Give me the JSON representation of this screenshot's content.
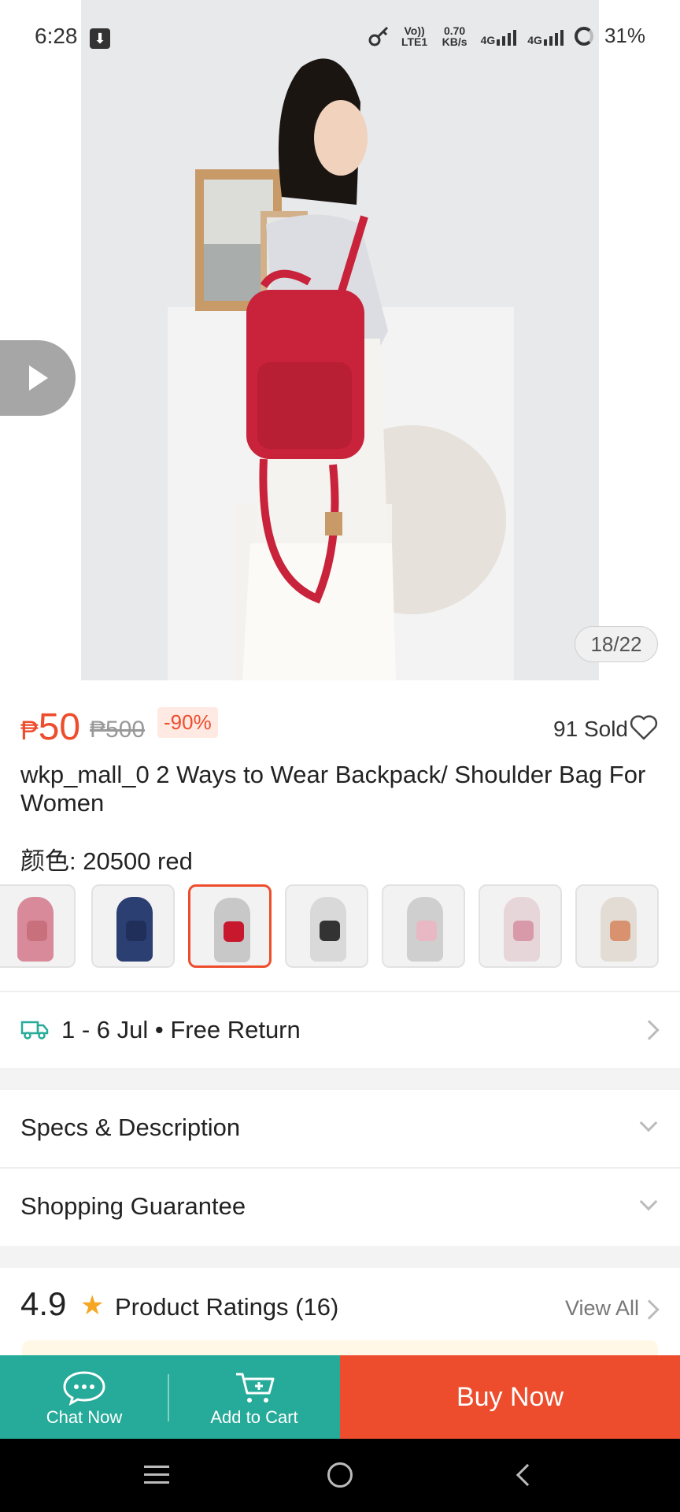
{
  "status_bar": {
    "time": "6:28",
    "net_volte": "Vo)) LTE1",
    "net_speed": "0.70 KB/s",
    "net_4g_1": "4G",
    "net_4g_2": "4G",
    "battery": "31%"
  },
  "gallery": {
    "counter": "18/22",
    "current_index": 18,
    "total": 22
  },
  "product": {
    "price_currency": "₱",
    "price": "50",
    "original_price": "₱500",
    "discount": "-90%",
    "sold": "91 Sold",
    "title": "wkp_mall_0 2 Ways to Wear Backpack/ Shoulder Bag For Women",
    "color_label": "颜色: 20500 red",
    "variants": [
      {
        "color": "#d98a9a",
        "bag": "#c9707d",
        "selected": false
      },
      {
        "color": "#2b3f73",
        "bag": "#1f2f5a",
        "selected": false
      },
      {
        "color": "#c8c8c8",
        "bag": "#c8182e",
        "selected": true
      },
      {
        "color": "#d9d9d9",
        "bag": "#333333",
        "selected": false
      },
      {
        "color": "#cfcfcf",
        "bag": "#e8b9c4",
        "selected": false
      },
      {
        "color": "#e6d6d9",
        "bag": "#d89aa8",
        "selected": false
      },
      {
        "color": "#e3dcd5",
        "bag": "#d99270",
        "selected": false
      }
    ]
  },
  "shipping": {
    "text": "1 - 6 Jul • Free Return"
  },
  "sections": {
    "specs": "Specs & Description",
    "guarantee": "Shopping Guarantee"
  },
  "ratings": {
    "score": "4.9",
    "label": "Product Ratings (16)",
    "view_all": "View All"
  },
  "actions": {
    "chat": "Chat Now",
    "cart": "Add to Cart",
    "buy": "Buy Now"
  },
  "colors": {
    "brand_orange": "#ee4d2d",
    "action_green": "#26aa99",
    "star": "#f5a623"
  }
}
